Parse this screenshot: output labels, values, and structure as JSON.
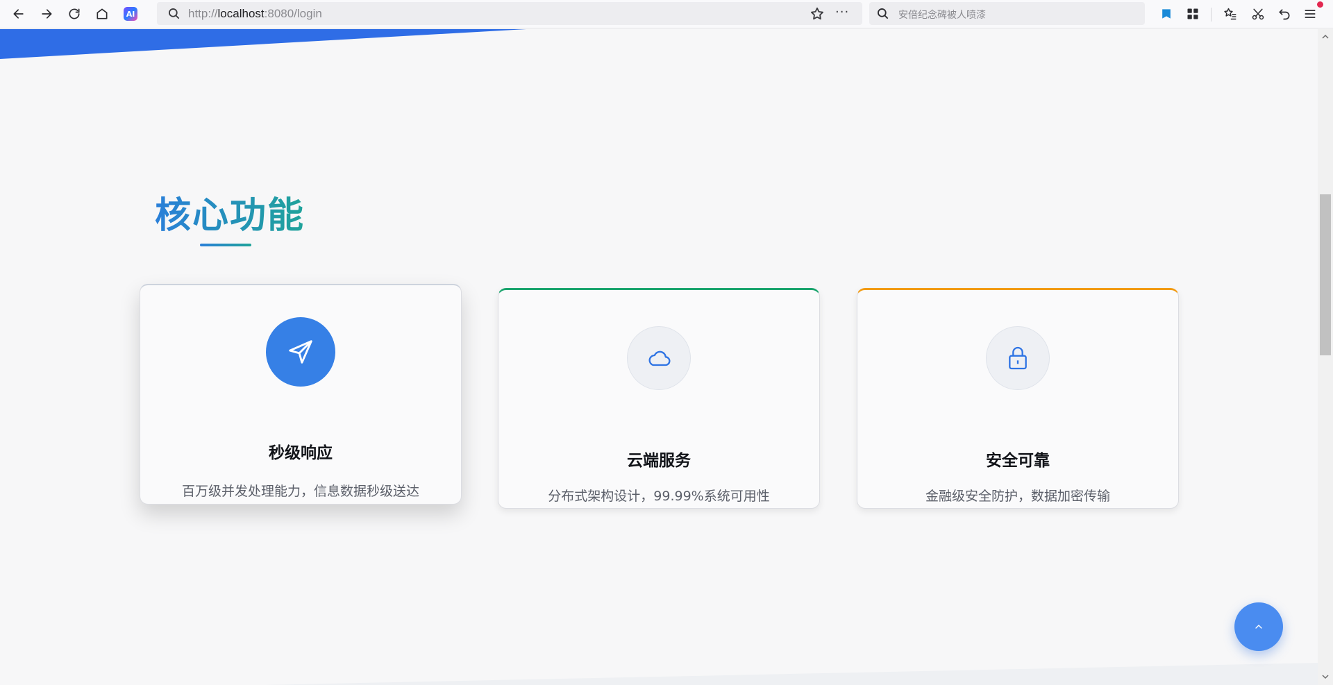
{
  "browser": {
    "url_scheme": "http://",
    "url_host": "localhost",
    "url_rest": ":8080/login",
    "search_placeholder": "安倍纪念碑被人喷漆",
    "ai_badge": "AI",
    "more_label": "···"
  },
  "features": {
    "title": "核心功能",
    "cards": [
      {
        "icon": "send-icon",
        "title": "秒级响应",
        "desc": "百万级并发处理能力，信息数据秒级送达",
        "accent": "#cdd3dd"
      },
      {
        "icon": "cloud-icon",
        "title": "云端服务",
        "desc": "分布式架构设计，99.99%系统可用性",
        "accent": "#1aa46d"
      },
      {
        "icon": "lock-icon",
        "title": "安全可靠",
        "desc": "金融级安全防护，数据加密传输",
        "accent": "#f29b14"
      }
    ]
  },
  "colors": {
    "primary": "#3680e6",
    "title_gradient_start": "#2a7fd9",
    "title_gradient_end": "#1fa39a"
  }
}
